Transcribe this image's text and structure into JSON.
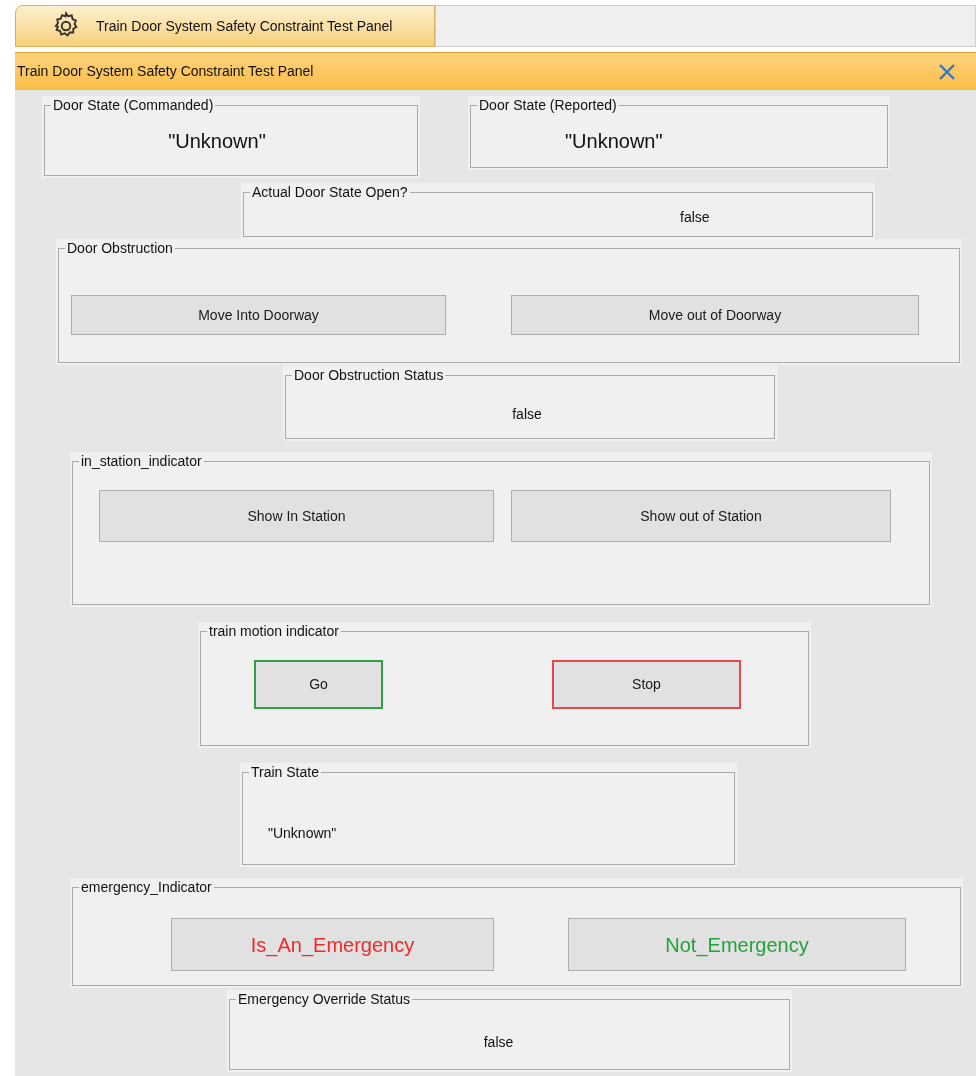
{
  "tab": {
    "title": "Train Door System Safety Constraint Test Panel",
    "selected": true
  },
  "panel": {
    "title": "Train Door System Safety Constraint Test Panel"
  },
  "groups": [
    {
      "kind": "value_large",
      "title": "Door State (Commanded)",
      "value": "\"Unknown\""
    },
    {
      "kind": "value_large",
      "title": "Door State (Reported)",
      "value": "\"Unknown\""
    },
    {
      "kind": "value",
      "title": "Actual Door State Open?",
      "value": "false"
    },
    {
      "kind": "buttons",
      "title": "Door Obstruction",
      "buttons": [
        {
          "kind": "plain",
          "label": "Move Into Doorway"
        },
        {
          "kind": "plain",
          "label": "Move out of Doorway"
        }
      ]
    },
    {
      "kind": "value",
      "title": "Door Obstruction Status",
      "value": "false"
    },
    {
      "kind": "buttons",
      "title": "in_station_indicator",
      "buttons": [
        {
          "kind": "plain",
          "label": "Show In Station"
        },
        {
          "kind": "plain",
          "label": "Show out of Station"
        }
      ]
    },
    {
      "kind": "buttons",
      "title": "train motion indicator",
      "buttons": [
        {
          "kind": "bordered",
          "label": "Go",
          "color": "#2ea043"
        },
        {
          "kind": "bordered",
          "label": "Stop",
          "color": "#e8474c"
        }
      ]
    },
    {
      "kind": "value",
      "title": "Train State",
      "value": "\"Unknown\""
    },
    {
      "kind": "buttons",
      "title": "emergency_Indicator",
      "buttons": [
        {
          "kind": "colored_text",
          "label": "Is_An_Emergency",
          "color": "#ee2a2a"
        },
        {
          "kind": "colored_text",
          "label": "Not_Emergency",
          "color": "#22a33a"
        }
      ]
    },
    {
      "kind": "value",
      "title": "Emergency Override Status",
      "value": "false"
    }
  ]
}
